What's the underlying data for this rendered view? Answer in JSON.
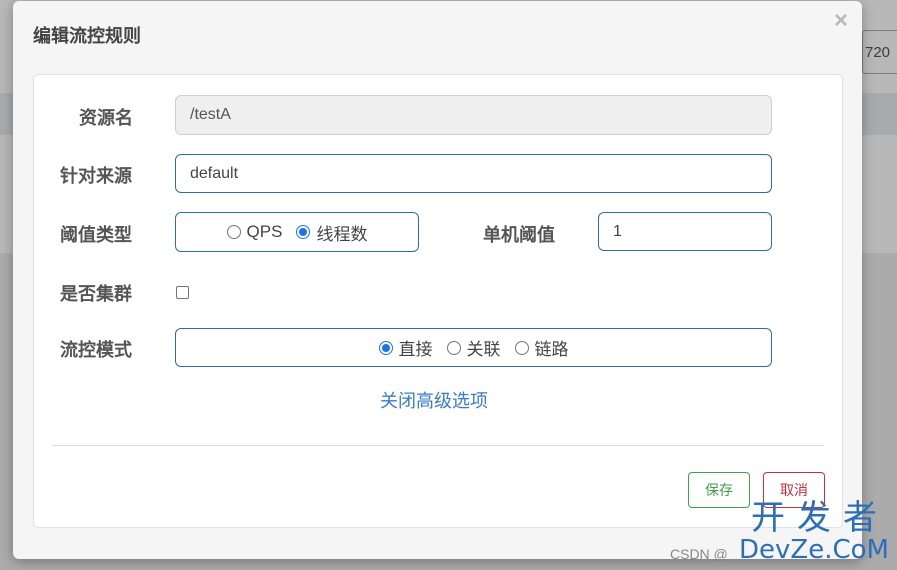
{
  "background": {
    "fragment_text": "720"
  },
  "dialog": {
    "title": "编辑流控规则",
    "close_glyph": "×"
  },
  "form": {
    "resource": {
      "label": "资源名",
      "value": "/testA"
    },
    "origin": {
      "label": "针对来源",
      "value": "default"
    },
    "threshold_type": {
      "label": "阈值类型",
      "options": [
        "QPS",
        "线程数"
      ],
      "selected": "线程数"
    },
    "single_threshold": {
      "label": "单机阈值",
      "value": "1"
    },
    "cluster": {
      "label": "是否集群",
      "checked": false
    },
    "flow_mode": {
      "label": "流控模式",
      "options": [
        "直接",
        "关联",
        "链路"
      ],
      "selected": "直接"
    },
    "advanced_link": "关闭高级选项"
  },
  "buttons": {
    "save": "保存",
    "cancel": "取消"
  },
  "watermark": {
    "cn": "开发者",
    "en": "DevZe.CoM",
    "csdn": "CSDN @"
  },
  "colors": {
    "accent": "#1a73e8",
    "save": "#3fa14a",
    "cancel": "#c9303c",
    "link": "#3a7bc8"
  },
  "icons": {
    "close": "close-icon"
  }
}
